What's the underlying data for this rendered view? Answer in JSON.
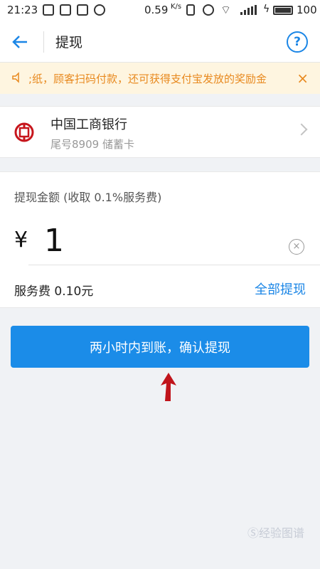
{
  "status_bar": {
    "time": "21:23",
    "speed": "0.59",
    "speed_unit": "K/s",
    "battery": "100"
  },
  "nav": {
    "title": "提现",
    "help_symbol": "?"
  },
  "notice": {
    "text": ";纸，顾客扫码付款，还可获得支付宝发放的奖励金",
    "close_symbol": "×"
  },
  "bank": {
    "name": "中国工商银行",
    "subtitle": "尾号8909 储蓄卡"
  },
  "withdraw": {
    "label": "提现金额 (收取 0.1%服务费)",
    "currency_symbol": "¥",
    "amount": "1",
    "fee_text": "服务费 0.10元",
    "all_label": "全部提现"
  },
  "confirm": {
    "label": "两小时内到账，确认提现"
  },
  "watermark": {
    "text": "Ⓢ经验图谱"
  },
  "colors": {
    "accent": "#1b8ce8",
    "notice_bg": "#fef5e0",
    "notice_text": "#e8891e",
    "arrow": "#c0141b"
  }
}
